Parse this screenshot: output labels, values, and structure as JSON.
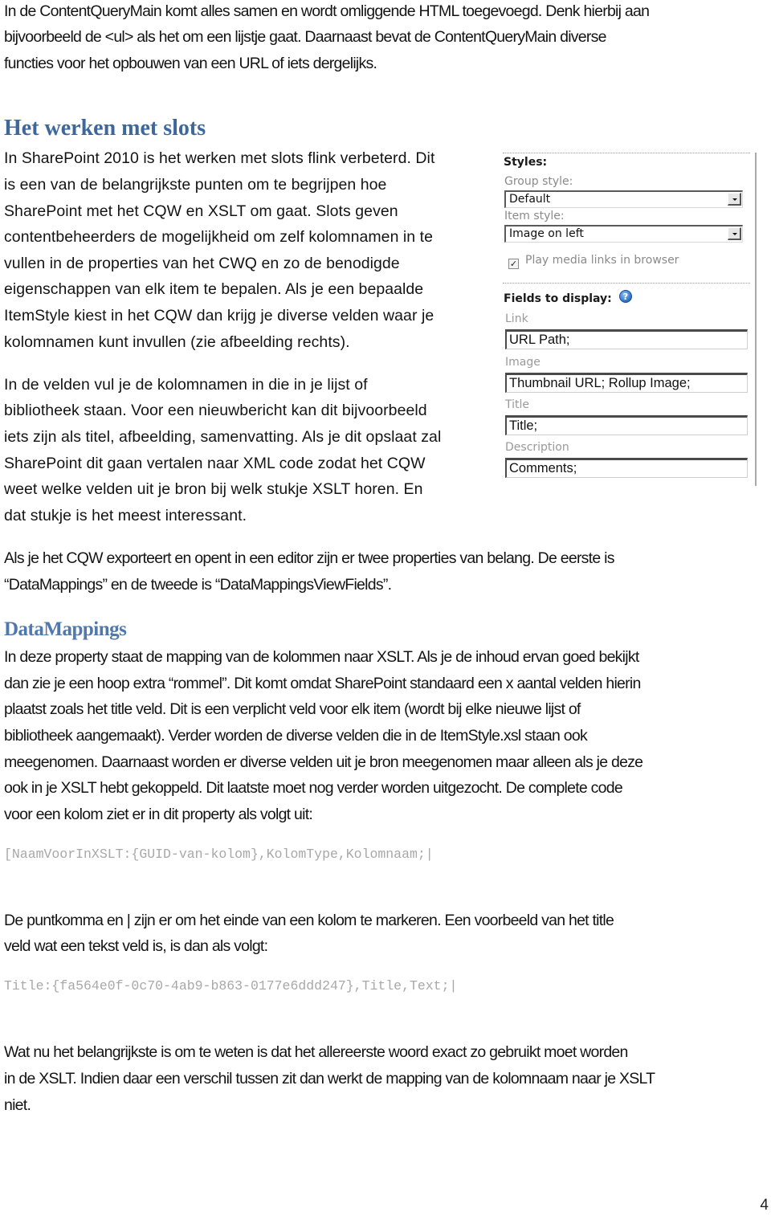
{
  "document": {
    "intro_paragraph": [
      "In de ContentQueryMain komt alles samen en wordt omliggende HTML toegevoegd. Denk hierbij aan",
      "bijvoorbeeld de <ul> als het om een lijstje gaat. Daarnaast bevat de ContentQueryMain diverse",
      "functies voor het opbouwen van een URL of iets dergelijks."
    ],
    "section_slots": {
      "heading": "Het werken met slots",
      "paragraph1": [
        "In SharePoint 2010 is het werken met slots flink verbeterd. Dit",
        "is een van de belangrijkste punten om te begrijpen hoe",
        "SharePoint met het CQW en XSLT om gaat. Slots geven",
        "contentbeheerders de mogelijkheid om zelf kolomnamen in te",
        "vullen in de properties van het CWQ en zo de benodigde",
        "eigenschappen van elk item te bepalen. Als je een bepaalde",
        "ItemStyle kiest in het CQW dan krijg je diverse velden waar je",
        "kolomnamen kunt invullen (zie afbeelding rechts)."
      ],
      "paragraph2": [
        "In de velden vul je de kolomnamen in die in je lijst of",
        "bibliotheek staan. Voor een nieuwbericht kan dit bijvoorbeeld",
        "iets zijn als titel, afbeelding, samenvatting. Als je dit opslaat zal",
        "SharePoint dit gaan vertalen naar XML code zodat het CQW",
        "weet welke velden uit je bron bij welk stukje XSLT horen. En",
        "dat stukje is het meest interessant."
      ],
      "paragraph3": [
        "Als je het CQW exporteert en opent in een editor zijn er twee properties van belang. De eerste is",
        "“DataMappings” en de tweede is “DataMappingsViewFields”."
      ]
    },
    "section_datamappings": {
      "heading": "DataMappings",
      "paragraph1": [
        "In deze property staat de mapping van de kolommen naar XSLT. Als je de inhoud ervan goed bekijkt",
        "dan zie je een hoop extra “rommel”. Dit komt omdat SharePoint standaard een x aantal velden hierin",
        "plaatst zoals het title veld. Dit is een verplicht veld voor elk item (wordt bij elke nieuwe lijst of",
        "bibliotheek aangemaakt). Verder worden de diverse velden die in de ItemStyle.xsl staan ook",
        "meegenomen. Daarnaast worden er diverse velden uit je bron meegenomen maar alleen als je deze",
        "ook in je XSLT hebt gekoppeld. Dit laatste moet nog verder worden uitgezocht. De complete code",
        "voor een kolom ziet er in dit property als volgt uit:"
      ],
      "code1": "[NaamVoorInXSLT:{GUID-van-kolom},KolomType,Kolomnaam;|",
      "paragraph2": [
        "De puntkomma en | zijn er om het einde van een kolom te markeren. Een voorbeeld van het title",
        "veld wat een tekst veld is, is dan als volgt:"
      ],
      "code2": "Title:{fa564e0f-0c70-4ab9-b863-0177e6ddd247},Title,Text;|",
      "paragraph3": [
        "Wat nu het belangrijkste is om te weten is dat het allereerste woord exact zo gebruikt moet worden",
        "in de XSLT. Indien daar een verschil tussen zit dan werkt de mapping van de kolomnaam naar je XSLT",
        "niet."
      ]
    },
    "page_number": "4"
  },
  "embedded_screenshot": {
    "styles_title": "Styles:",
    "group_style_label": "Group style:",
    "group_style_value": "Default",
    "item_style_label": "Item style:",
    "item_style_value": "Image on left",
    "play_media_label": "Play media links in browser",
    "play_media_checked": true,
    "check_glyph": "✓",
    "fields_title": "Fields to display:",
    "help_glyph": "?",
    "fields": [
      {
        "label": "Link",
        "value": "URL Path;"
      },
      {
        "label": "Image",
        "value": "Thumbnail URL; Rollup Image;"
      },
      {
        "label": "Title",
        "value": "Title;"
      },
      {
        "label": "Description",
        "value": "Comments;"
      }
    ]
  },
  "colors": {
    "heading": "#3e689c",
    "body_text": "#141414",
    "code_text": "#a8a8a8"
  }
}
